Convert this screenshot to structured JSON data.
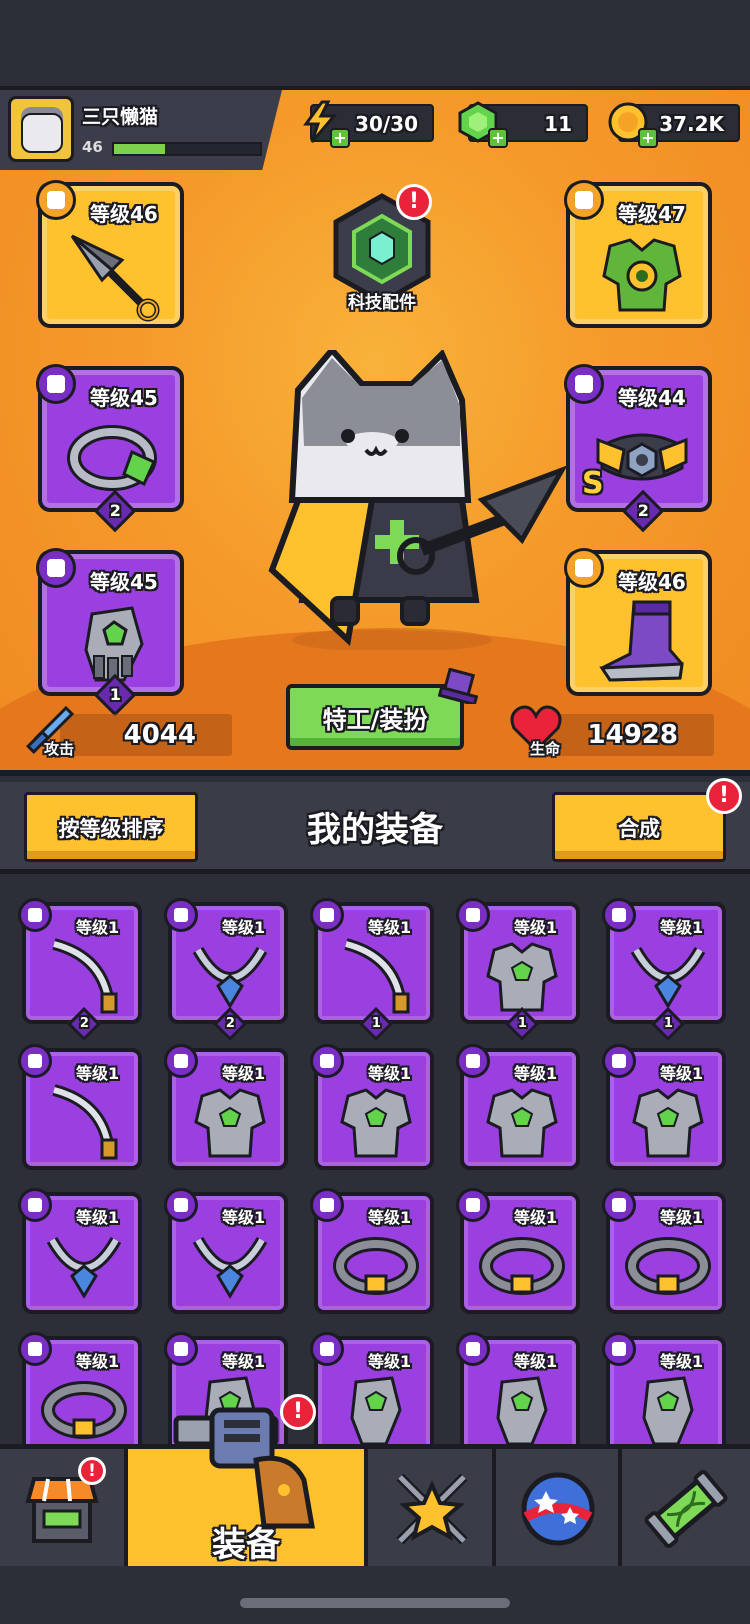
{
  "player": {
    "name": "三只懒猫",
    "level": "46",
    "xp_fraction": 0.35
  },
  "resources": {
    "energy": "30/30",
    "gems": "11",
    "coins": "37.2K"
  },
  "hero": {
    "tech_label": "科技配件",
    "tech_alert": "!",
    "agent_button": "特工/装扮",
    "attack_label": "攻击",
    "attack_value": "4044",
    "hp_label": "生命",
    "hp_value": "14928",
    "slots": {
      "weapon": {
        "level": "等级46"
      },
      "armor": {
        "level": "等级47"
      },
      "necklace": {
        "level": "等级45",
        "count": "2"
      },
      "belt": {
        "level": "等级44",
        "count": "2",
        "grade": "S"
      },
      "gloves": {
        "level": "等级45",
        "count": "1"
      },
      "boots": {
        "level": "等级46"
      }
    }
  },
  "inventory": {
    "sort_button": "按等级排序",
    "title": "我的装备",
    "merge_button": "合成",
    "merge_alert": "!",
    "items": [
      {
        "level": "等级1",
        "count": "2",
        "type": "weapon"
      },
      {
        "level": "等级1",
        "count": "2",
        "type": "necklace"
      },
      {
        "level": "等级1",
        "count": "1",
        "type": "weapon"
      },
      {
        "level": "等级1",
        "count": "1",
        "type": "armor"
      },
      {
        "level": "等级1",
        "count": "1",
        "type": "necklace"
      },
      {
        "level": "等级1",
        "count": "",
        "type": "weapon"
      },
      {
        "level": "等级1",
        "count": "",
        "type": "armor"
      },
      {
        "level": "等级1",
        "count": "",
        "type": "armor"
      },
      {
        "level": "等级1",
        "count": "",
        "type": "armor"
      },
      {
        "level": "等级1",
        "count": "",
        "type": "armor"
      },
      {
        "level": "等级1",
        "count": "",
        "type": "necklace"
      },
      {
        "level": "等级1",
        "count": "",
        "type": "necklace"
      },
      {
        "level": "等级1",
        "count": "",
        "type": "belt"
      },
      {
        "level": "等级1",
        "count": "",
        "type": "belt"
      },
      {
        "level": "等级1",
        "count": "",
        "type": "belt"
      },
      {
        "level": "等级1",
        "count": "",
        "type": "belt"
      },
      {
        "level": "等级1",
        "count": "",
        "type": "gloves"
      },
      {
        "level": "等级1",
        "count": "",
        "type": "gloves"
      },
      {
        "level": "等级1",
        "count": "",
        "type": "gloves"
      },
      {
        "level": "等级1",
        "count": "",
        "type": "gloves"
      }
    ]
  },
  "nav": {
    "equip_label": "装备",
    "shop_alert": "!",
    "equip_alert": "!"
  },
  "colors": {
    "purple": "#9a3fe0",
    "yellow": "#ffc22e",
    "orange": "#f59a2a",
    "green": "#7ed957"
  }
}
